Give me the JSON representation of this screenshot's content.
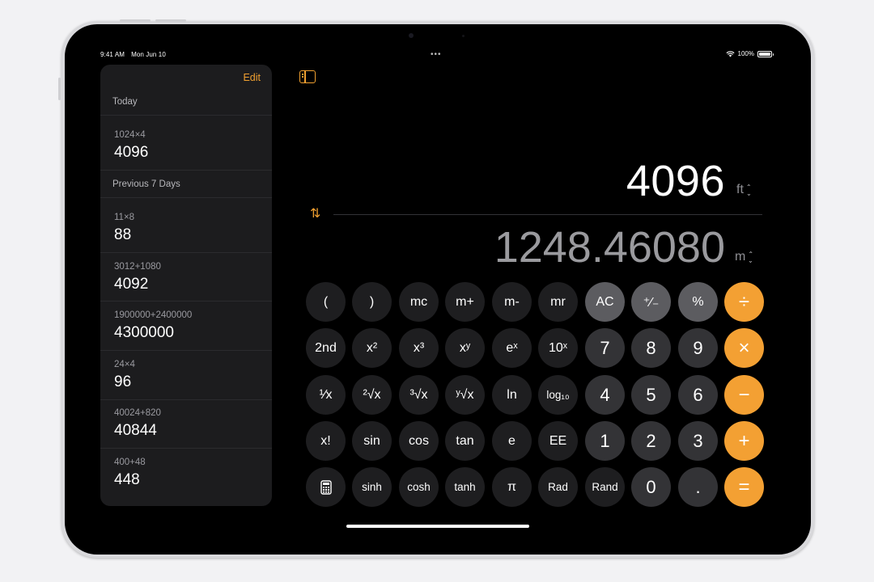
{
  "status": {
    "time": "9:41 AM",
    "date": "Mon Jun 10",
    "battery": "100%",
    "dots": "•••"
  },
  "sidebar": {
    "edit_label": "Edit",
    "sections": [
      {
        "title": "Today",
        "items": [
          {
            "expr": "1024×4",
            "result": "4096"
          }
        ]
      },
      {
        "title": "Previous 7 Days",
        "items": [
          {
            "expr": "11×8",
            "result": "88"
          },
          {
            "expr": "3012+1080",
            "result": "4092"
          },
          {
            "expr": "1900000+2400000",
            "result": "4300000"
          },
          {
            "expr": "24×4",
            "result": "96"
          },
          {
            "expr": "40024+820",
            "result": "40844"
          },
          {
            "expr": "400+48",
            "result": "448"
          }
        ]
      }
    ]
  },
  "display": {
    "primary_value": "4096",
    "primary_unit": "ft",
    "secondary_value": "1248.46080",
    "secondary_unit": "m"
  },
  "icons": {
    "sidebar_toggle": "sidebar-toggle-icon",
    "swap": "swap-units-icon",
    "calculator": "calculator-icon",
    "chevron": "chevron-updown-icon"
  },
  "keypad": {
    "rows": [
      [
        "(",
        ")",
        "mc",
        "m+",
        "m-",
        "mr",
        "AC",
        "⁺∕₋",
        "%",
        "÷"
      ],
      [
        "2nd",
        "x²",
        "x³",
        "xʸ",
        "eˣ",
        "10ˣ",
        "7",
        "8",
        "9",
        "×"
      ],
      [
        "¹∕x",
        "²√x",
        "³√x",
        "ʸ√x",
        "ln",
        "log₁₀",
        "4",
        "5",
        "6",
        "−"
      ],
      [
        "x!",
        "sin",
        "cos",
        "tan",
        "e",
        "EE",
        "1",
        "2",
        "3",
        "+"
      ],
      [
        "",
        "sinh",
        "cosh",
        "tanh",
        "π",
        "Rad",
        "Rand",
        "0",
        ".",
        "="
      ]
    ]
  },
  "colors": {
    "accent": "#f3a033",
    "key_dark": "#1e1e20",
    "key_number": "#333336",
    "key_gray": "#5c5c60"
  }
}
